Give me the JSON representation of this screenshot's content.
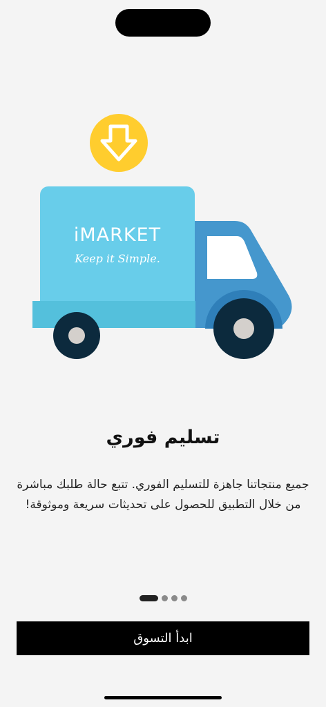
{
  "illustration": {
    "brand": "iMARKET",
    "tagline": "Keep it Simple.",
    "icon": "download-arrow-icon"
  },
  "onboarding": {
    "title": "تسليم فوري",
    "description_line1": "جميع منتجاتنا جاهزة للتسليم الفوري. تتبع حالة طلبك مباشرة",
    "description_line2": "من خلال التطبيق للحصول على تحديثات سريعة وموثوقة!",
    "page_indicator": {
      "current": 1,
      "total": 4
    }
  },
  "cta": {
    "label": "ابدأ التسوق"
  },
  "colors": {
    "background": "#f4f4f4",
    "truck_box": "#68cdea",
    "truck_cab": "#4597cd",
    "arrow_badge": "#ffcd2e",
    "wheel": "#0c2a3d",
    "button": "#000000"
  }
}
